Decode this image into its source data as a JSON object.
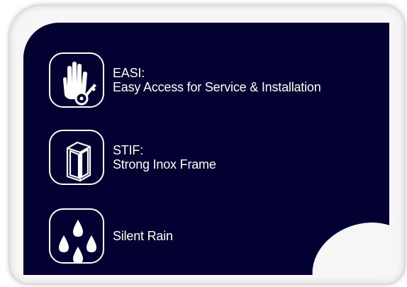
{
  "features": [
    {
      "icon": "hand-with-key-icon",
      "title": "EASI:",
      "subtitle": "Easy Access for Service & Installation"
    },
    {
      "icon": "frame-box-icon",
      "title": "STIF:",
      "subtitle": "Strong Inox Frame"
    },
    {
      "icon": "rain-drops-icon",
      "title": "Silent Rain"
    }
  ],
  "colors": {
    "panel": "#020132",
    "frame": "#f6f6f6",
    "text": "#ffffff"
  }
}
